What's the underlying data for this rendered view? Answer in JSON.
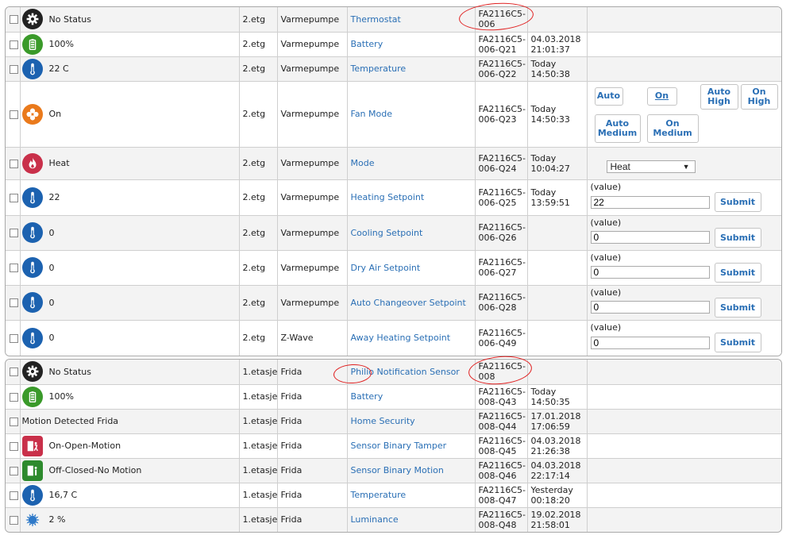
{
  "groups": [
    {
      "rows": [
        {
          "icon": "gear-icon",
          "icon_style": "ic-black",
          "status": "No Status",
          "floor": "2.etg",
          "room": "Varmepumpe",
          "name": "Thermostat",
          "addr": "FA2116C5-006",
          "time": "",
          "action": null
        },
        {
          "icon": "battery-icon",
          "icon_style": "ic-green",
          "status": "100%",
          "floor": "2.etg",
          "room": "Varmepumpe",
          "name": "Battery",
          "addr": "FA2116C5-006-Q21",
          "time": "04.03.2018 21:01:37",
          "action": null
        },
        {
          "icon": "thermometer-icon",
          "icon_style": "ic-blue",
          "status": "22 C",
          "floor": "2.etg",
          "room": "Varmepumpe",
          "name": "Temperature",
          "addr": "FA2116C5-006-Q22",
          "time": "Today 14:50:38",
          "action": null
        },
        {
          "icon": "fan-icon",
          "icon_style": "ic-orange",
          "status": "On",
          "floor": "2.etg",
          "room": "Varmepumpe",
          "name": "Fan Mode",
          "addr": "FA2116C5-006-Q23",
          "time": "Today 14:50:33",
          "action": {
            "type": "buttons",
            "buttons": [
              "Auto",
              "On",
              "Auto High",
              "On High",
              "Auto Medium",
              "On Medium"
            ]
          }
        },
        {
          "icon": "flame-icon",
          "icon_style": "ic-red",
          "status": "Heat",
          "floor": "2.etg",
          "room": "Varmepumpe",
          "name": "Mode",
          "addr": "FA2116C5-006-Q24",
          "time": "Today 10:04:27",
          "action": {
            "type": "select",
            "value": "Heat"
          }
        },
        {
          "icon": "thermometer-icon",
          "icon_style": "ic-blue",
          "status": "22",
          "floor": "2.etg",
          "room": "Varmepumpe",
          "name": "Heating Setpoint",
          "addr": "FA2116C5-006-Q25",
          "time": "Today 13:59:51",
          "action": {
            "type": "value",
            "label": "(value)",
            "value": "22",
            "submit": "Submit"
          }
        },
        {
          "icon": "thermometer-icon",
          "icon_style": "ic-blue",
          "status": "0",
          "floor": "2.etg",
          "room": "Varmepumpe",
          "name": "Cooling Setpoint",
          "addr": "FA2116C5-006-Q26",
          "time": "",
          "action": {
            "type": "value",
            "label": "(value)",
            "value": "0",
            "submit": "Submit"
          }
        },
        {
          "icon": "thermometer-icon",
          "icon_style": "ic-blue",
          "status": "0",
          "floor": "2.etg",
          "room": "Varmepumpe",
          "name": "Dry Air Setpoint",
          "addr": "FA2116C5-006-Q27",
          "time": "",
          "action": {
            "type": "value",
            "label": "(value)",
            "value": "0",
            "submit": "Submit"
          }
        },
        {
          "icon": "thermometer-icon",
          "icon_style": "ic-blue",
          "status": "0",
          "floor": "2.etg",
          "room": "Varmepumpe",
          "name": "Auto Changeover Setpoint",
          "addr": "FA2116C5-006-Q28",
          "time": "",
          "action": {
            "type": "value",
            "label": "(value)",
            "value": "0",
            "submit": "Submit"
          }
        },
        {
          "icon": "thermometer-icon",
          "icon_style": "ic-blue",
          "status": "0",
          "floor": "2.etg",
          "room": "Z-Wave",
          "name": "Away Heating Setpoint",
          "addr": "FA2116C5-006-Q49",
          "time": "",
          "action": {
            "type": "value",
            "label": "(value)",
            "value": "0",
            "submit": "Submit"
          }
        }
      ]
    },
    {
      "rows": [
        {
          "icon": "gear-icon",
          "icon_style": "ic-black",
          "status": "No Status",
          "floor": "1.etasje",
          "room": "Frida",
          "name": "Philio Notification Sensor",
          "addr": "FA2116C5-008",
          "time": "",
          "action": null
        },
        {
          "icon": "battery-icon",
          "icon_style": "ic-green",
          "status": "100%",
          "floor": "1.etasje",
          "room": "Frida",
          "name": "Battery",
          "addr": "FA2116C5-008-Q43",
          "time": "Today 14:50:35",
          "action": null
        },
        {
          "icon": "",
          "icon_style": "",
          "status": "Motion Detected Frida",
          "floor": "1.etasje",
          "room": "Frida",
          "name": "Home Security",
          "addr": "FA2116C5-008-Q44",
          "time": "17.01.2018 17:06:59",
          "action": null
        },
        {
          "icon": "door-open-motion-icon",
          "icon_style": "ic-sq-red",
          "status": "On-Open-Motion",
          "floor": "1.etasje",
          "room": "Frida",
          "name": "Sensor Binary Tamper",
          "addr": "FA2116C5-008-Q45",
          "time": "04.03.2018 21:26:38",
          "action": null
        },
        {
          "icon": "door-closed-icon",
          "icon_style": "ic-sq-green",
          "status": "Off-Closed-No Motion",
          "floor": "1.etasje",
          "room": "Frida",
          "name": "Sensor Binary Motion",
          "addr": "FA2116C5-008-Q46",
          "time": "04.03.2018 22:17:14",
          "action": null
        },
        {
          "icon": "thermometer-icon",
          "icon_style": "ic-blue",
          "status": "16,7 C",
          "floor": "1.etasje",
          "room": "Frida",
          "name": "Temperature",
          "addr": "FA2116C5-008-Q47",
          "time": "Yesterday 00:18:20",
          "action": null
        },
        {
          "icon": "luminance-icon",
          "icon_style": "ic-lum",
          "status": "2 %",
          "floor": "1.etasje",
          "room": "Frida",
          "name": "Luminance",
          "addr": "FA2116C5-008-Q48",
          "time": "19.02.2018 21:58:01",
          "action": null
        }
      ]
    }
  ],
  "colors": {
    "link": "#2a6fb5",
    "annotation": "#e02020"
  }
}
